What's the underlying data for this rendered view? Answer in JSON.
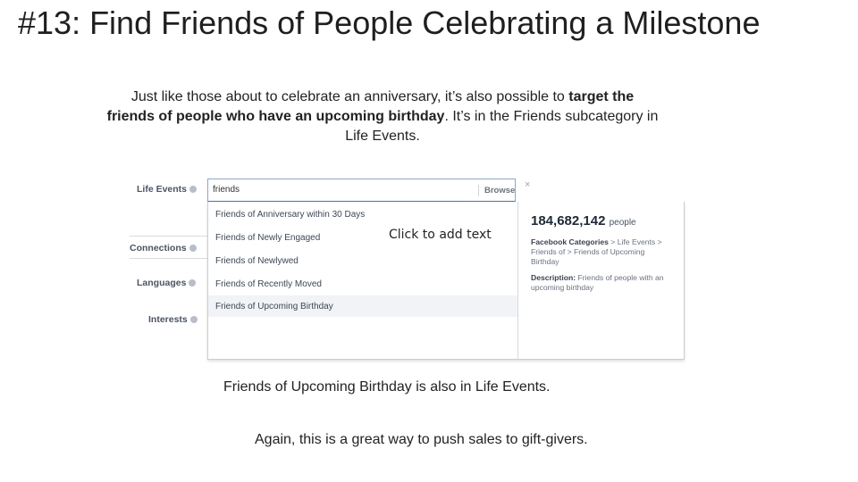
{
  "slide": {
    "title": "#13: Find Friends of People Celebrating a Milestone",
    "intro_before": "Just like those about to celebrate an anniversary, it’s also possible to ",
    "intro_bold": "target the friends of people who have an upcoming birthday",
    "intro_after": ". It’s in the Friends subcategory in Life Events.",
    "footer_line1": "Friends of Upcoming Birthday is also in Life Events.",
    "footer_line2": "Again, this is a great way to push sales to gift-givers.",
    "placeholder": "Click to add text"
  },
  "panel": {
    "labels": {
      "life_events": "Life Events",
      "connections": "Connections",
      "languages": "Languages",
      "interests": "Interests"
    },
    "search": {
      "value": "friends",
      "browse_label": "Browse",
      "close_glyph": "×"
    },
    "options": [
      {
        "label": "Friends of Anniversary within 30 Days"
      },
      {
        "label": "Friends of Newly Engaged"
      },
      {
        "label": "Friends of Newlywed"
      },
      {
        "label": "Friends of Recently Moved"
      },
      {
        "label": "Friends of Upcoming Birthday"
      }
    ],
    "highlighted_index": 4,
    "details": {
      "count": "184,682,142",
      "count_unit": "people",
      "categories_label": "Facebook Categories",
      "categories_path": " > Life Events > Friends of > Friends of Upcoming Birthday",
      "description_label": "Description:",
      "description_text": " Friends of people with an upcoming birthday"
    }
  }
}
